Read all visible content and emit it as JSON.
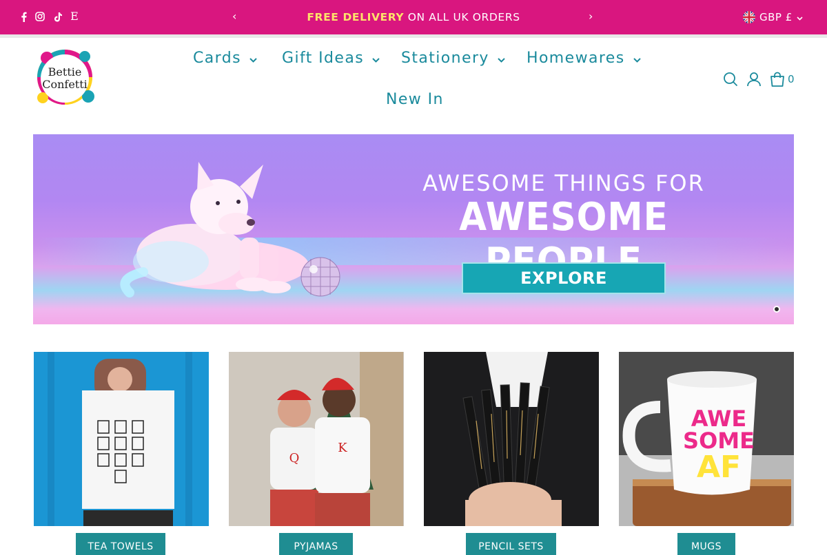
{
  "announcement": {
    "strong": "FREE DELIVERY",
    "rest": " ON ALL UK ORDERS",
    "prev_arrow": "‹",
    "next_arrow": "›"
  },
  "social_icons": [
    "facebook-icon",
    "instagram-icon",
    "tiktok-icon",
    "etsy-icon"
  ],
  "etsy_letter": "E",
  "currency": {
    "label": "GBP £"
  },
  "brand": {
    "logo_line1": "Bettie",
    "logo_line2": "Confetti"
  },
  "nav": {
    "items": [
      {
        "label": "Cards"
      },
      {
        "label": "Gift Ideas"
      },
      {
        "label": "Stationery"
      },
      {
        "label": "Homewares"
      },
      {
        "label": "New In"
      }
    ]
  },
  "cart": {
    "count": "0"
  },
  "hero": {
    "line1": "AWESOME THINGS FOR",
    "line2": "AWESOME PEOPLE",
    "button": "EXPLORE"
  },
  "products": [
    {
      "label": "TEA TOWELS"
    },
    {
      "label": "PYJAMAS"
    },
    {
      "label": "PENCIL SETS"
    },
    {
      "label": "MUGS"
    }
  ],
  "product_art": {
    "mug_text_1": "AWE",
    "mug_text_2": "SOME",
    "mug_text_3": "AF",
    "pyjama_q": "Q",
    "pyjama_k": "K"
  },
  "colors": {
    "topbar": "#d9167f",
    "accent_teal": "#1a8a9c",
    "highlight_yellow": "#fde26a",
    "label_bg": "#1f8d92"
  }
}
